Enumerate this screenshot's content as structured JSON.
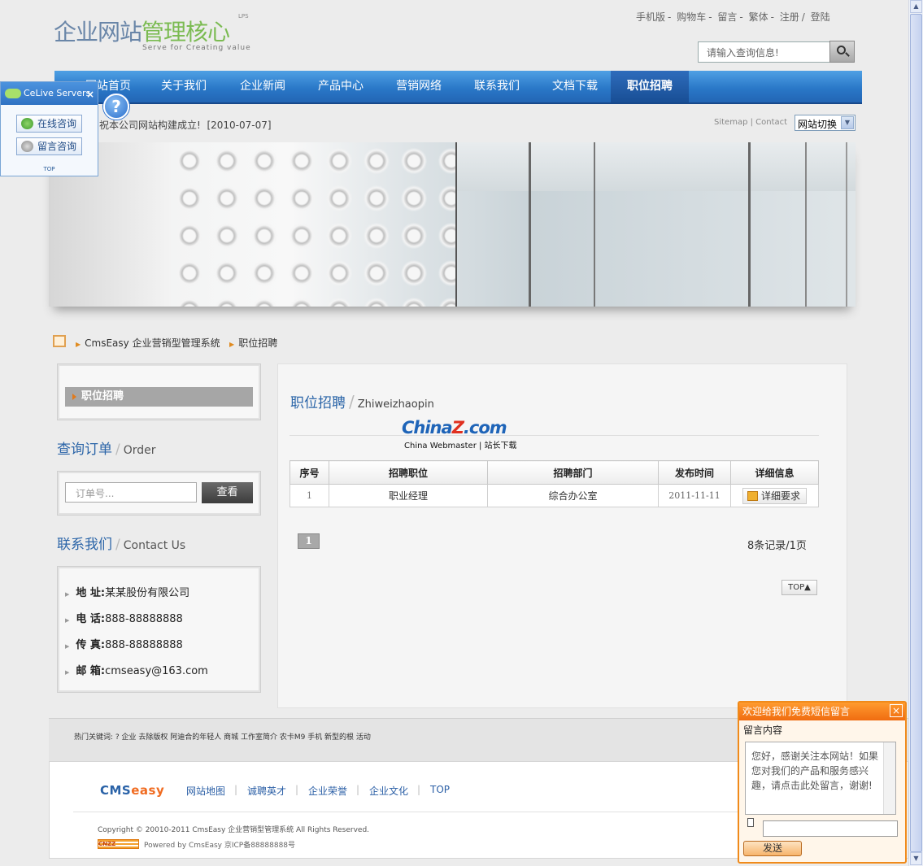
{
  "header": {
    "logo_part1": "企业网站",
    "logo_part2": "管理核心",
    "logo_mark": "LPS",
    "slogan": "Serve for Creating value",
    "top_links": [
      "手机版",
      "购物车",
      "留言",
      "繁体",
      "注册",
      "登陆"
    ],
    "search_placeholder": "请输入查询信息!"
  },
  "nav": {
    "items": [
      "网站首页",
      "关于我们",
      "企业新闻",
      "产品中心",
      "营销网络",
      "联系我们",
      "文档下载",
      "职位招聘"
    ],
    "active": "职位招聘"
  },
  "notice": {
    "text": "祝本公司网站构建成立!",
    "date": "[2010-07-07]",
    "sitemap_label": "Sitemap",
    "contact_label": "Contact",
    "site_switch": "网站切换"
  },
  "breadcrumb": {
    "site": "CmsEasy 企业营销型管理系统",
    "current": "职位招聘"
  },
  "sidebar": {
    "category_item": "职位招聘",
    "order_title": "查询订单",
    "order_title_en": "Order",
    "order_placeholder": "订单号...",
    "order_button": "查看",
    "contact_title": "联系我们",
    "contact_title_en": "Contact Us",
    "contact": [
      {
        "label": "地 址:",
        "value": "某某股份有限公司"
      },
      {
        "label": "电 话:",
        "value": "888-88888888"
      },
      {
        "label": "传 真:",
        "value": "888-88888888"
      },
      {
        "label": "邮 箱:",
        "value": "cmseasy@163.com"
      }
    ]
  },
  "main": {
    "title": "职位招聘",
    "title_en": "Zhiweizhaopin",
    "watermark_main": "China",
    "watermark_z": "Z",
    "watermark_com": ".com",
    "watermark_sub": "China Webmaster | 站长下载",
    "columns": [
      "序号",
      "招聘职位",
      "招聘部门",
      "发布时间",
      "详细信息"
    ],
    "rows": [
      {
        "no": "1",
        "position": "职业经理",
        "department": "综合办公室",
        "date": "2011-11-11",
        "detail": "详细要求"
      }
    ],
    "page": "1",
    "records": "8条记录/1页",
    "top_label": "TOP"
  },
  "footer": {
    "keywords": "热门关键词: ? 企业 去除版权 阿迪合的年轻人 商城 工作室简介 农卡M9 手机 新型的根 活动",
    "logo_cms": "CMS",
    "logo_easy": "easy",
    "links": [
      "网站地图",
      "诚聘英才",
      "企业荣誉",
      "企业文化",
      "TOP"
    ],
    "copyright": "Copyright © 20010-2011 CmsEasy 企业营销型管理系统 All Rights Reserved.",
    "cnzz": "CNZZ",
    "powered": "Powered by CmsEasy  京ICP备88888888号"
  },
  "celive": {
    "title": "CeLive Servers",
    "online_consult": "在线咨询",
    "message_consult": "留言咨询",
    "top": "TOP",
    "help": "?"
  },
  "message_widget": {
    "title": "欢迎给我们免费短信留言",
    "label": "留言内容",
    "text": "您好，感谢关注本网站！如果您对我们的产品和服务感兴趣，请点击此处留言，谢谢!",
    "send": "发送"
  }
}
